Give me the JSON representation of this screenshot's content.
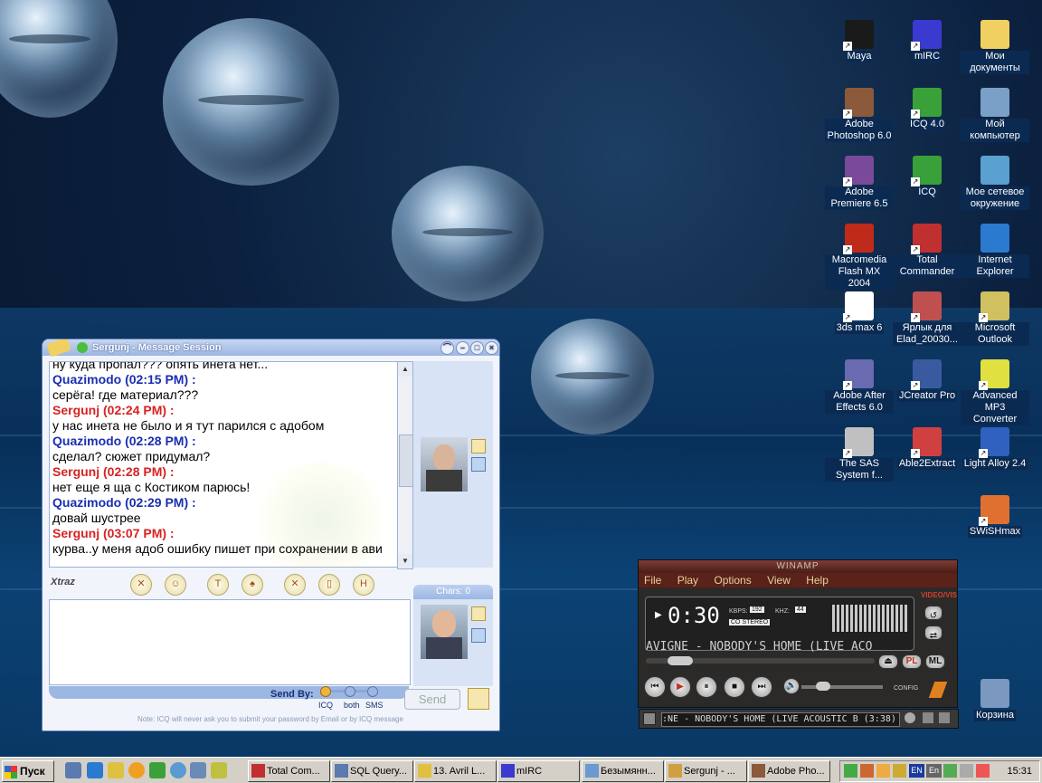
{
  "desktop_icons": [
    {
      "label": "Maya",
      "name": "maya-icon",
      "color": "#1a1a1a"
    },
    {
      "label": "mIRC",
      "name": "mirc-icon",
      "color": "#3a3ad0"
    },
    {
      "label": "Мои документы",
      "name": "my-documents-icon",
      "color": "#f0d060"
    },
    {
      "label": "Adobe Photoshop 6.0",
      "name": "photoshop-icon",
      "color": "#8b5a3a"
    },
    {
      "label": "ICQ 4.0",
      "name": "icq4-icon",
      "color": "#3aa03a"
    },
    {
      "label": "Мой компьютер",
      "name": "my-computer-icon",
      "color": "#7aa0c8"
    },
    {
      "label": "Adobe Premiere 6.5",
      "name": "premiere-icon",
      "color": "#7a4a9a"
    },
    {
      "label": "ICQ",
      "name": "icq-pro-icon",
      "color": "#3aa03a"
    },
    {
      "label": "Мое сетевое окружение",
      "name": "network-icon",
      "color": "#5aa0d0"
    },
    {
      "label": "Macromedia Flash MX 2004",
      "name": "flash-icon",
      "color": "#c02a1a"
    },
    {
      "label": "Total Commander",
      "name": "total-commander-icon",
      "color": "#c03030"
    },
    {
      "label": "Internet Explorer",
      "name": "ie-icon",
      "color": "#2a7ad0"
    },
    {
      "label": "3ds max 6",
      "name": "3dsmax-icon",
      "color": "#ffffff"
    },
    {
      "label": "Ярлык для Elad_20030...",
      "name": "elad-icon",
      "color": "#c05050"
    },
    {
      "label": "Microsoft Outlook",
      "name": "outlook-icon",
      "color": "#d0c060"
    },
    {
      "label": "Adobe After Effects 6.0",
      "name": "after-effects-icon",
      "color": "#6a6ab0"
    },
    {
      "label": "JCreator Pro",
      "name": "jcreator-icon",
      "color": "#3a5aa0"
    },
    {
      "label": "Advanced MP3 Converter",
      "name": "mp3-converter-icon",
      "color": "#e0e040"
    },
    {
      "label": "The SAS System f...",
      "name": "sas-icon",
      "color": "#c0c0c0"
    },
    {
      "label": "Able2Extract",
      "name": "able2extract-icon",
      "color": "#d04040"
    },
    {
      "label": "Light Alloy 2.4",
      "name": "light-alloy-icon",
      "color": "#3060c0"
    },
    {
      "label": "SWiSHmax",
      "name": "swishmax-icon",
      "color": "#e07030"
    },
    {
      "label": "Корзина",
      "name": "recycle-bin-icon",
      "color": "#7a98c0"
    }
  ],
  "icq": {
    "title": "Sergunj - Message Session",
    "messages": [
      {
        "who": "",
        "text": "ну куда пропал??? опять инета нет..."
      },
      {
        "who": "Quazimodo (02:15 PM) :",
        "side": "q",
        "text": "серёга! где материал???"
      },
      {
        "who": "Sergunj (02:24 PM) :",
        "side": "s",
        "text": "у нас инета не было и я тут парился с адобом"
      },
      {
        "who": "Quazimodo (02:28 PM) :",
        "side": "q",
        "text": "сделал? сюжет придумал?"
      },
      {
        "who": "Sergunj (02:28 PM) :",
        "side": "s",
        "text": "нет еще я ща с Костиком парюсь!"
      },
      {
        "who": "Quazimodo (02:29 PM) :",
        "side": "q",
        "text": "довай шустрее"
      },
      {
        "who": "Sergunj (03:07 PM) :",
        "side": "s",
        "text": "курва..у меня адоб ошибку пишет при сохранении в ави"
      }
    ],
    "xtraz": "Xtraz",
    "chars_label": "Chars:",
    "chars_value": "0",
    "send_by_label": "Send By:",
    "send_options": [
      "ICQ",
      "both",
      "SMS"
    ],
    "send_button": "Send",
    "note": "Note: ICQ will never ask you to submit your password by Email or by ICQ message"
  },
  "winamp": {
    "title": "WINAMP",
    "menu": [
      "File",
      "Play",
      "Options",
      "View",
      "Help"
    ],
    "time": "0:30",
    "kbps": "192",
    "khz": "44",
    "stereo": "CO STEREO",
    "kbps_label": "KBPS:",
    "khz_label": "KHZ:",
    "marquee": "AVIGNE - NOBODY'S HOME (LIVE ACO",
    "video_vis": "VIDEO/VIS",
    "config": "CONFIG",
    "pl_label": "PL",
    "ml_label": "ML",
    "playlist_text": ":NE - NOBODY'S HOME (LIVE ACOUSTIC B (3:38)"
  },
  "taskbar": {
    "start": "Пуск",
    "buttons": [
      {
        "label": "Total Com...",
        "name": "task-total-commander"
      },
      {
        "label": "SQL Query...",
        "name": "task-sql-query"
      },
      {
        "label": "13. Avril L...",
        "name": "task-avril"
      },
      {
        "label": "mIRC",
        "name": "task-mirc"
      },
      {
        "label": "Безымянн...",
        "name": "task-untitled"
      },
      {
        "label": "Sergunj - ...",
        "name": "task-sergunj"
      },
      {
        "label": "Adobe Pho...",
        "name": "task-photoshop"
      }
    ],
    "lang": "EN",
    "lang2": "En",
    "clock": "15:31"
  }
}
